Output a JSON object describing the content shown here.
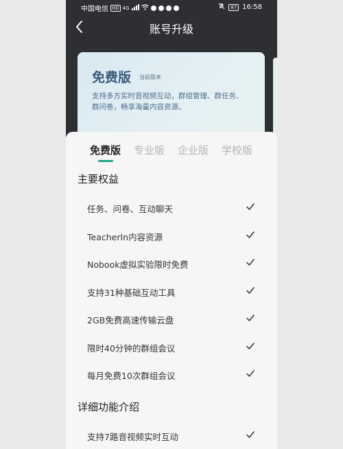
{
  "status_bar": {
    "carrier": "中国电信",
    "hd": "HD",
    "network": "4G",
    "battery": "87",
    "time": "16:58"
  },
  "header": {
    "title": "账号升级"
  },
  "plan_card": {
    "title": "免费版",
    "tag": "当前版本",
    "description": "支持多方实时音视频互动，群组管理、群任务、群问卷，畅享海量内容资源。"
  },
  "tabs": [
    {
      "label": "免费版",
      "active": true
    },
    {
      "label": "专业版",
      "active": false
    },
    {
      "label": "企业版",
      "active": false
    },
    {
      "label": "学校版",
      "active": false
    }
  ],
  "main_benefits": {
    "title": "主要权益",
    "items": [
      {
        "label": "任务、问卷、互动聊天",
        "included": true
      },
      {
        "label": "TeacherIn内容资源",
        "included": true
      },
      {
        "label": "Nobook虚拟实验限时免费",
        "included": true
      },
      {
        "label": "支持31种基础互动工具",
        "included": true
      },
      {
        "label": "2GB免费高速传输云盘",
        "included": true
      },
      {
        "label": "限时40分钟的群组会议",
        "included": true
      },
      {
        "label": "每月免费10次群组会议",
        "included": true
      }
    ]
  },
  "detail_features": {
    "title": "详细功能介绍",
    "items": [
      {
        "label": "支持7路音视频实时互动",
        "included": true
      }
    ]
  },
  "icons": {
    "back": "chevron-left-icon",
    "check": "check-icon"
  },
  "colors": {
    "header_bg": "#2e2f33",
    "accent": "#1fa889",
    "card_title": "#3a5a7c"
  }
}
